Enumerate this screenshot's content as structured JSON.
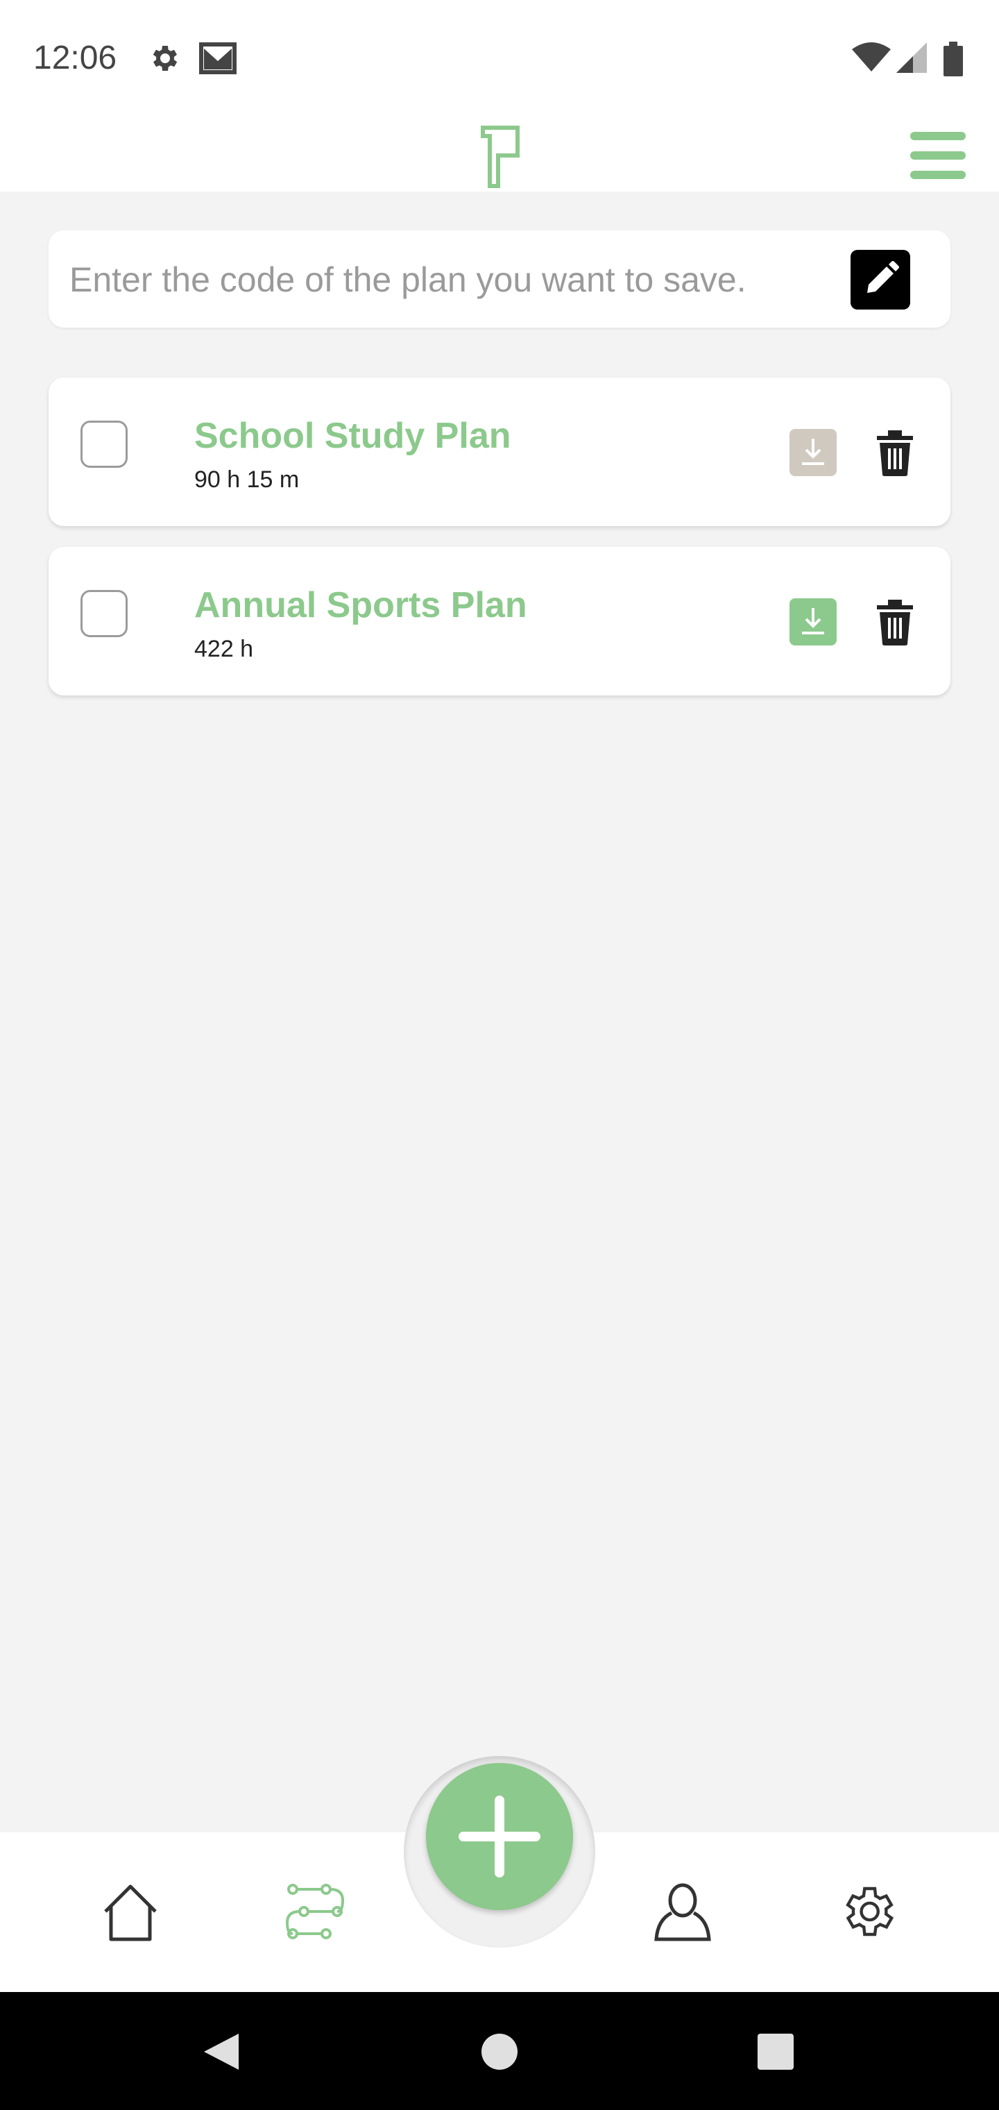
{
  "status": {
    "time": "12:06"
  },
  "search": {
    "placeholder": "Enter the code of the plan you want to save."
  },
  "plans": [
    {
      "title": "School Study Plan",
      "duration": "90 h 15 m",
      "download_state": "disabled",
      "download_color": "#cfc9bf"
    },
    {
      "title": "Annual Sports Plan",
      "duration": "422 h",
      "download_state": "enabled",
      "download_color": "#8cc98c"
    }
  ],
  "bottom_nav": [
    {
      "name": "home-icon",
      "active": false
    },
    {
      "name": "plans-icon",
      "active": true
    },
    {
      "name": "profile-icon",
      "active": false
    },
    {
      "name": "settings-icon",
      "active": false
    }
  ],
  "colors": {
    "accent": "#8cc98c",
    "background": "#f3f3f3"
  }
}
